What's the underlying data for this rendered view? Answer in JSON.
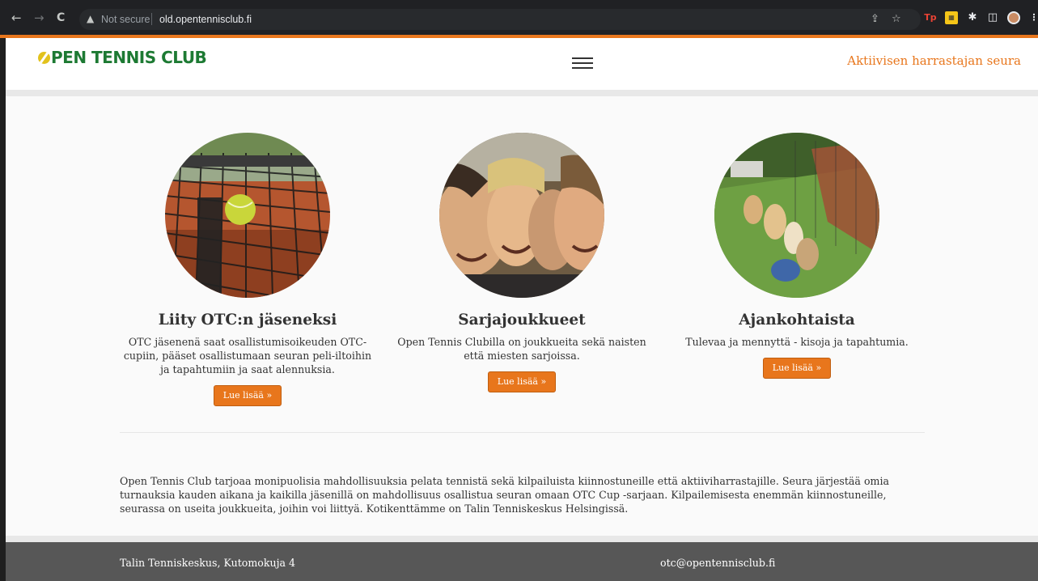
{
  "browser": {
    "nav": {
      "back": "←",
      "forward": "→",
      "reload": "C"
    },
    "security_icon": "▲",
    "security_label": "Not secure",
    "url": "old.opentennisclub.fi",
    "icons": [
      "share-icon",
      "star-icon",
      "tp-extension-icon",
      "extension-icon",
      "puzzle-icon",
      "sidepanel-icon",
      "profile-avatar"
    ]
  },
  "header": {
    "logo_text": "PEN TENNIS CLUB",
    "tagline": "Aktiivisen harrastajan seura",
    "accent_color": "#e8761c"
  },
  "features": [
    {
      "title": "Liity OTC:n jäseneksi",
      "text": "OTC jäsenenä saat osallistumisoikeuden OTC-cupiin, pääset osallistumaan seuran peli-iltoihin ja tapahtumiin ja saat alennuksia.",
      "button": "Lue lisää »"
    },
    {
      "title": "Sarjajoukkueet",
      "text": "Open Tennis Clubilla on joukkueita sekä naisten että miesten sarjoissa.",
      "button": "Lue lisää »"
    },
    {
      "title": "Ajankohtaista",
      "text": "Tulevaa ja mennyttä - kisoja ja tapahtumia.",
      "button": "Lue lisää »"
    }
  ],
  "description": "Open Tennis Club tarjoaa monipuolisia mahdollisuuksia pelata tennistä sekä kilpailuista kiinnostuneille että aktiiviharrastajille. Seura järjestää omia turnauksia kauden aikana ja kaikilla jäsenillä on mahdollisuus osallistua seuran omaan OTC Cup -sarjaan. Kilpailemisesta enemmän kiinnostuneille, seurassa on useita joukkueita, joihin voi liittyä. Kotikenttämme on Talin Tenniskeskus Helsingissä.",
  "footer": {
    "address": "Talin Tenniskeskus, Kutomokuja 4",
    "email": "otc@opentennisclub.fi"
  }
}
